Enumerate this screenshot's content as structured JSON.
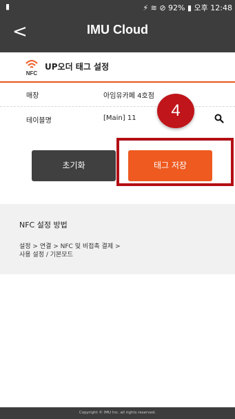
{
  "status_bar": {
    "left_icon": "app-notification",
    "right_text": "⚡ ≋ ⊘ 92% ▮ 오후 12:48"
  },
  "app_bar": {
    "back_label": "<",
    "title": "IMU Cloud"
  },
  "section": {
    "icon": "nfc-icon",
    "icon_text": "NFC",
    "title": "UP오더 태그 설정"
  },
  "fields": [
    {
      "label": "매장",
      "value": "아임유카페 4호점"
    },
    {
      "label": "테이블명",
      "value": "[Main] 11"
    }
  ],
  "badge_number": "4",
  "buttons": {
    "reset_label": "초기화",
    "save_label": "태그 저장"
  },
  "info": {
    "title": "NFC 설정 방법",
    "line1": "설정 > 연결 > NFC 및 비접촉 결제 >",
    "line2": "사용 설정 / 기본모드"
  },
  "footer": "Copyright © IMU Inc. all rights reserved.",
  "colors": {
    "header": "#3d3d3d",
    "accent": "#ee5a1f",
    "highlight": "#b30e14",
    "badge": "#c0151a"
  }
}
